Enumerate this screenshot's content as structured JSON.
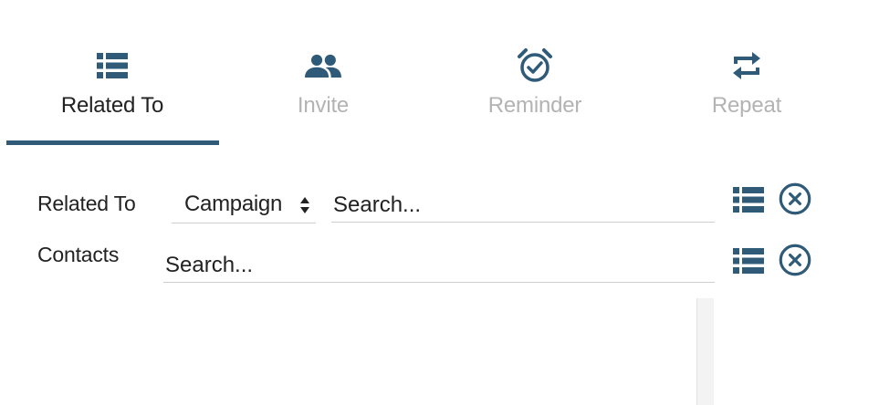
{
  "tabs": {
    "items": [
      {
        "label": "Related To",
        "icon": "list-icon",
        "active": true
      },
      {
        "label": "Invite",
        "icon": "people-icon",
        "active": false
      },
      {
        "label": "Reminder",
        "icon": "alarm-clock-icon",
        "active": false
      },
      {
        "label": "Repeat",
        "icon": "repeat-icon",
        "active": false
      }
    ]
  },
  "form": {
    "related_to": {
      "label": "Related To",
      "select_value": "Campaign",
      "search_placeholder": "Search..."
    },
    "contacts": {
      "label": "Contacts",
      "search_placeholder": "Search..."
    }
  },
  "colors": {
    "accent": "#2f5a78",
    "inactive_text": "#b3b3b3",
    "text": "#222222",
    "field_border": "#cfcfcf"
  }
}
